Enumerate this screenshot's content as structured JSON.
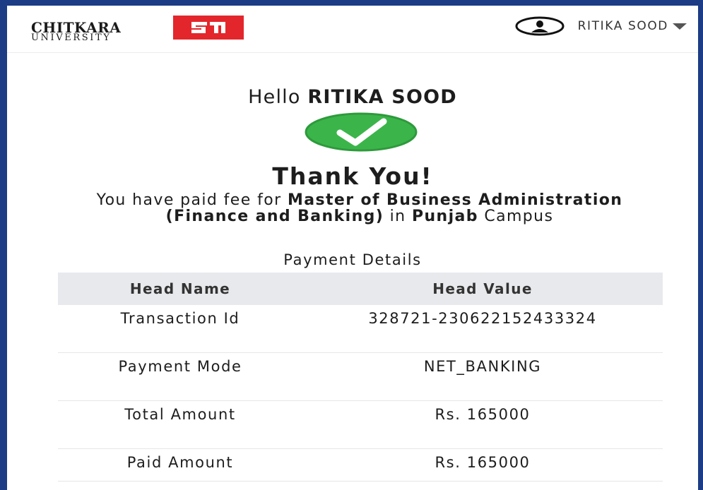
{
  "brand": {
    "name": "CHITKARA",
    "sub": "UNIVERSITY",
    "accent_color": "#e3262b",
    "badge_icon": "chitkara-monogram-icon"
  },
  "user": {
    "name": "RITIKA SOOD",
    "icon": "user-avatar-icon"
  },
  "greeting": {
    "prefix": "Hello",
    "name": "RITIKA SOOD"
  },
  "status_icon": "check-circle-icon",
  "status_color": "#3bb54a",
  "thanks": "Thank You!",
  "message": {
    "prefix": "You have paid fee for",
    "program": "Master of Business Administration (Finance and Banking)",
    "middle": "in",
    "campus": "Punjab",
    "suffix": "Campus"
  },
  "payment_details_title": "Payment Details",
  "table": {
    "headers": [
      "Head Name",
      "Head Value"
    ],
    "rows": [
      {
        "name": "Transaction Id",
        "value": "328721-230622152433324"
      },
      {
        "name": "Payment Mode",
        "value": "NET_BANKING"
      },
      {
        "name": "Total Amount",
        "value": "Rs. 165000"
      },
      {
        "name": "Paid Amount",
        "value": "Rs. 165000"
      }
    ]
  }
}
